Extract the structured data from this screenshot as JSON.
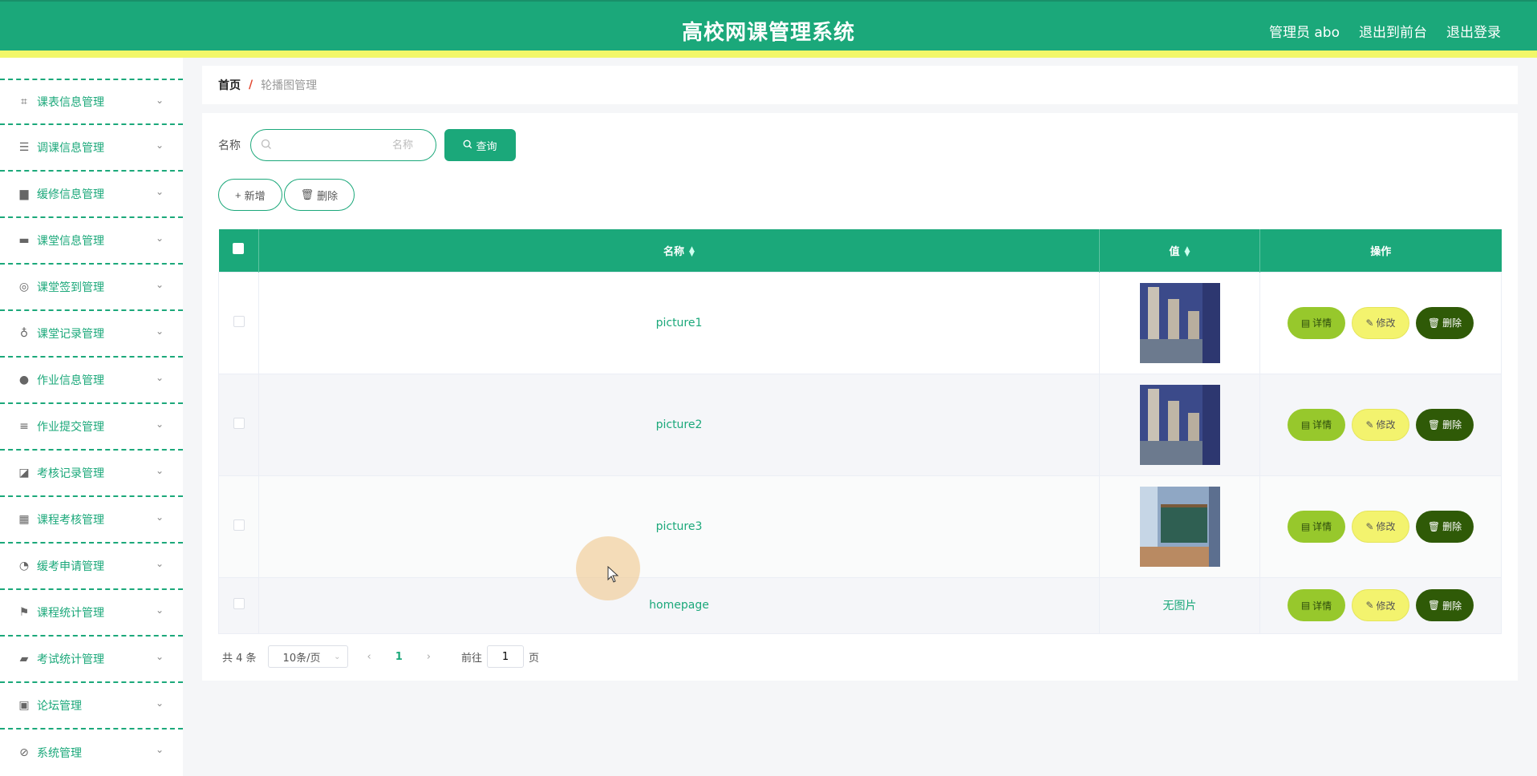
{
  "header": {
    "title": "高校网课管理系统",
    "admin_label": "管理员 abo",
    "front_label": "退出到前台",
    "logout_label": "退出登录"
  },
  "sidebar": {
    "items": [
      {
        "label": "课表信息管理",
        "icon": "crop-icon"
      },
      {
        "label": "调课信息管理",
        "icon": "list-icon"
      },
      {
        "label": "缓修信息管理",
        "icon": "briefcase-icon"
      },
      {
        "label": "课堂信息管理",
        "icon": "monitor-icon"
      },
      {
        "label": "课堂签到管理",
        "icon": "crosshair-icon"
      },
      {
        "label": "课堂记录管理",
        "icon": "microphone-icon"
      },
      {
        "label": "作业信息管理",
        "icon": "bulb-icon"
      },
      {
        "label": "作业提交管理",
        "icon": "menu-icon"
      },
      {
        "label": "考核记录管理",
        "icon": "chart-icon"
      },
      {
        "label": "课程考核管理",
        "icon": "grid-icon"
      },
      {
        "label": "缓考申请管理",
        "icon": "gauge-icon"
      },
      {
        "label": "课程统计管理",
        "icon": "flag-icon"
      },
      {
        "label": "考试统计管理",
        "icon": "ticket-icon"
      },
      {
        "label": "论坛管理",
        "icon": "clipboard-icon"
      },
      {
        "label": "系统管理",
        "icon": "compass-icon"
      }
    ]
  },
  "breadcrumb": {
    "home": "首页",
    "separator": "/",
    "current": "轮播图管理"
  },
  "search": {
    "label": "名称",
    "placeholder": "名称",
    "value": "",
    "button": "查询"
  },
  "actions": {
    "add": "新增",
    "delete": "删除"
  },
  "table": {
    "headers": {
      "name": "名称",
      "value": "值",
      "ops": "操作"
    },
    "rows": [
      {
        "name": "picture1",
        "value": "",
        "has_image": true
      },
      {
        "name": "picture2",
        "value": "",
        "has_image": true
      },
      {
        "name": "picture3",
        "value": "",
        "has_image": true
      },
      {
        "name": "homepage",
        "value": "无图片",
        "has_image": false
      }
    ],
    "op_labels": {
      "detail": "详情",
      "edit": "修改",
      "delete": "删除"
    }
  },
  "pager": {
    "total": "共 4 条",
    "page_size": "10条/页",
    "current_page": "1",
    "goto_label": "前往",
    "goto_value": "1",
    "page_unit": "页"
  },
  "colors": {
    "primary": "#1ba87a",
    "accent_bar": "#f2f769",
    "detail_btn": "#97c82c",
    "edit_btn": "#f3f36e",
    "delete_btn": "#2f5a07"
  }
}
